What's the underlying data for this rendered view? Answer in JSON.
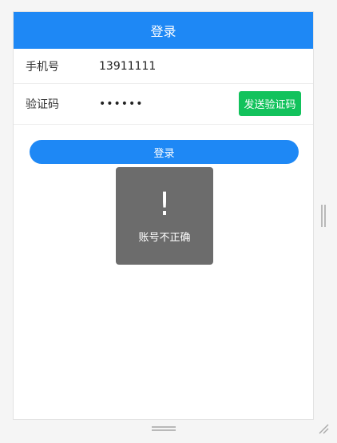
{
  "header": {
    "title": "登录"
  },
  "form": {
    "phone_label": "手机号",
    "phone_value": "13911111",
    "code_label": "验证码",
    "code_value": "••••••",
    "send_code_label": "发送验证码"
  },
  "actions": {
    "login_label": "登录"
  },
  "toast": {
    "icon": "!",
    "message": "账号不正确"
  },
  "colors": {
    "primary": "#1e88f5",
    "send_button": "#12c25c",
    "toast_bg": "#606060"
  }
}
